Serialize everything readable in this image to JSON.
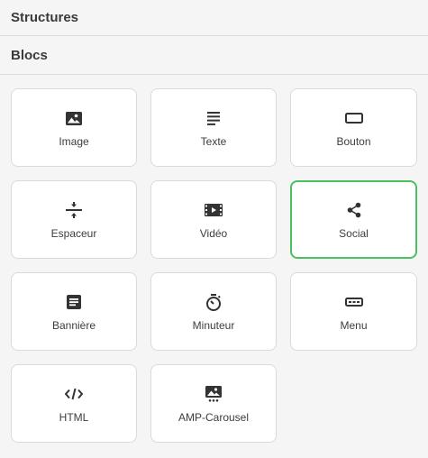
{
  "sections": {
    "structures_title": "Structures",
    "blocs_title": "Blocs"
  },
  "blocks": [
    {
      "label": "Image",
      "icon": "image-icon"
    },
    {
      "label": "Texte",
      "icon": "text-lines-icon"
    },
    {
      "label": "Bouton",
      "icon": "button-icon"
    },
    {
      "label": "Espaceur",
      "icon": "spacer-icon"
    },
    {
      "label": "Vidéo",
      "icon": "video-icon"
    },
    {
      "label": "Social",
      "icon": "share-icon",
      "selected": true
    },
    {
      "label": "Bannière",
      "icon": "banner-icon"
    },
    {
      "label": "Minuteur",
      "icon": "timer-icon"
    },
    {
      "label": "Menu",
      "icon": "menu-icon"
    },
    {
      "label": "HTML",
      "icon": "code-icon"
    },
    {
      "label": "AMP-Carousel",
      "icon": "carousel-icon"
    }
  ],
  "colors": {
    "selected_border": "#4cbf5f",
    "icon": "#333333"
  }
}
